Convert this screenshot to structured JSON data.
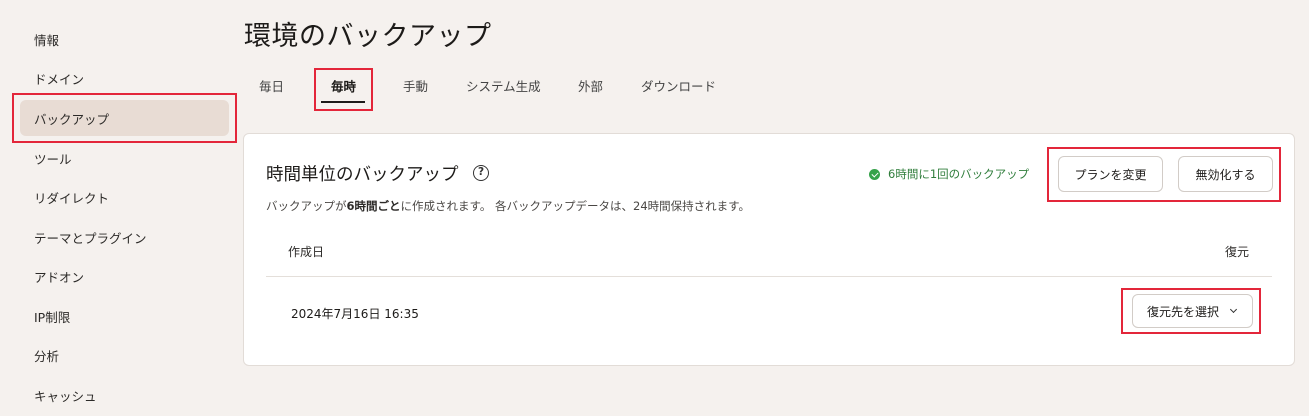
{
  "sidebar": {
    "items": [
      {
        "label": "情報",
        "active": false
      },
      {
        "label": "ドメイン",
        "active": false
      },
      {
        "label": "バックアップ",
        "active": true
      },
      {
        "label": "ツール",
        "active": false
      },
      {
        "label": "リダイレクト",
        "active": false
      },
      {
        "label": "テーマとプラグイン",
        "active": false
      },
      {
        "label": "アドオン",
        "active": false
      },
      {
        "label": "IP制限",
        "active": false
      },
      {
        "label": "分析",
        "active": false
      },
      {
        "label": "キャッシュ",
        "active": false
      }
    ]
  },
  "page": {
    "title": "環境のバックアップ"
  },
  "tabs": [
    {
      "label": "毎日",
      "active": false
    },
    {
      "label": "毎時",
      "active": true
    },
    {
      "label": "手動",
      "active": false
    },
    {
      "label": "システム生成",
      "active": false
    },
    {
      "label": "外部",
      "active": false
    },
    {
      "label": "ダウンロード",
      "active": false
    }
  ],
  "card": {
    "title": "時間単位のバックアップ",
    "help_icon": "question-icon",
    "help_glyph": "?",
    "description_prefix": "バックアップが",
    "description_bold": "6時間ごと",
    "description_suffix": "に作成されます。 各バックアップデータは、24時間保持されます。",
    "status_text": "6時間に1回のバックアップ",
    "status_color": "#2f7d3b",
    "change_plan_label": "プランを変更",
    "disable_label": "無効化する",
    "table": {
      "columns": [
        "作成日",
        "復元"
      ],
      "rows": [
        {
          "created": "2024年7月16日 16:35",
          "restore_label": "復元先を選択"
        }
      ]
    }
  },
  "colors": {
    "background": "#f5f1ee",
    "active_sidebar": "#e8dcd4",
    "highlight": "#e3263a",
    "status_green": "#36a24a"
  }
}
